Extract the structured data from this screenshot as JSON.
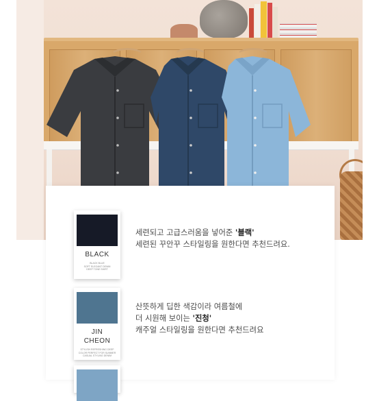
{
  "colors": {
    "black_swatch": "#161a27",
    "jin_cheon_swatch": "#4f7590",
    "yeon_cheon_swatch": "#7ea5c5",
    "black_shirt": "#3a3c40",
    "dark_denim_shirt": "#2f4868",
    "light_denim_shirt": "#8cb6d9"
  },
  "icons": [
    "hanger-icon"
  ],
  "colors_list": [
    {
      "swatch_label": "BLACK",
      "swatch_caption": [
        "BLACK BLUE",
        "SOFT ELEGANT DENIM",
        "DEEP TONE SHIRT"
      ],
      "line1": "세련되고 고급스러움을 넣어준 ",
      "highlight": "'블랙'",
      "line2": "세련된 꾸안꾸 스타일링을 원한다면 추천드려요."
    },
    {
      "swatch_label_1": "JIN",
      "swatch_label_2": "CHEON",
      "swatch_caption": [
        "STYLISH REFRESHING DEEP",
        "COLOR PERFECT FOR SUMMER",
        "CASUAL STYLING DENIM"
      ],
      "line1": "산뜻하게 딥한 색감이라 여름철에",
      "line2_prefix": "더 시원해 보이는 ",
      "highlight": "'진청'",
      "line3": "캐주얼 스타일링을 원한다면 추천드려요"
    }
  ]
}
